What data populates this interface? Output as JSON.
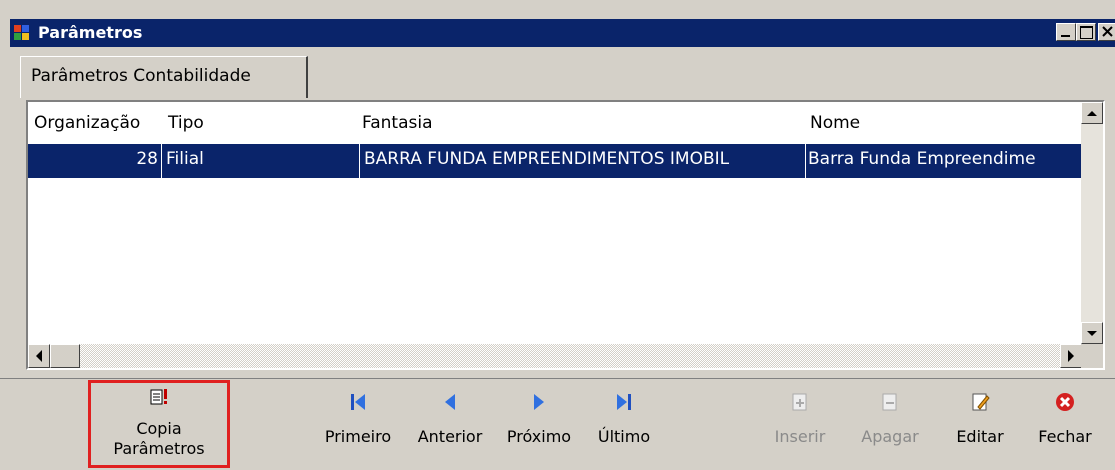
{
  "window": {
    "title": "Parâmetros"
  },
  "tabs": [
    {
      "label": "Parâmetros Contabilidade"
    }
  ],
  "grid": {
    "columns": [
      "Organização",
      "Tipo",
      "Fantasia",
      "Nome"
    ],
    "rows": [
      {
        "organizacao": "28",
        "tipo": "Filial",
        "fantasia": "BARRA FUNDA EMPREENDIMENTOS IMOBIL",
        "nome": "Barra Funda Empreendime"
      }
    ]
  },
  "toolbar": {
    "copia_line1": "Copia",
    "copia_line2": "Parâmetros",
    "primeiro": "Primeiro",
    "anterior": "Anterior",
    "proximo": "Próximo",
    "ultimo": "Último",
    "inserir": "Inserir",
    "apagar": "Apagar",
    "editar": "Editar",
    "fechar": "Fechar"
  },
  "colors": {
    "titlebar": "#0a246a",
    "selection": "#0a246a",
    "highlight_box": "#e02020"
  }
}
